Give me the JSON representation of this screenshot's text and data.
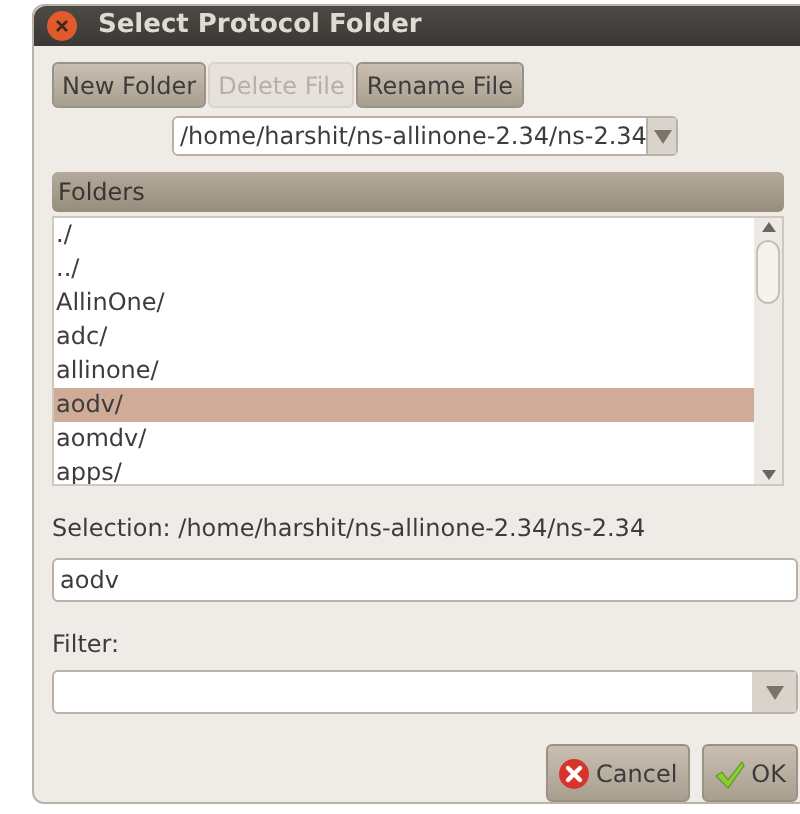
{
  "window": {
    "title": "Select Protocol Folder"
  },
  "toolbar": [
    {
      "label": "New Folder",
      "disabled": false
    },
    {
      "label": "Delete File",
      "disabled": true
    },
    {
      "label": "Rename File",
      "disabled": false
    }
  ],
  "path": {
    "value": "/home/harshit/ns-allinone-2.34/ns-2.34"
  },
  "folders": {
    "header": "Folders",
    "items": [
      {
        "label": "./",
        "selected": false
      },
      {
        "label": "../",
        "selected": false
      },
      {
        "label": "AllinOne/",
        "selected": false
      },
      {
        "label": "adc/",
        "selected": false
      },
      {
        "label": "allinone/",
        "selected": false
      },
      {
        "label": "aodv/",
        "selected": true
      },
      {
        "label": "aomdv/",
        "selected": false
      },
      {
        "label": "apps/",
        "selected": false
      }
    ]
  },
  "selection": {
    "label": "Selection: /home/harshit/ns-allinone-2.34/ns-2.34",
    "value": "aodv"
  },
  "filter": {
    "label": "Filter:"
  },
  "buttons": [
    {
      "kind": "cancel",
      "label": "Cancel"
    },
    {
      "kind": "ok",
      "label": "OK"
    }
  ]
}
